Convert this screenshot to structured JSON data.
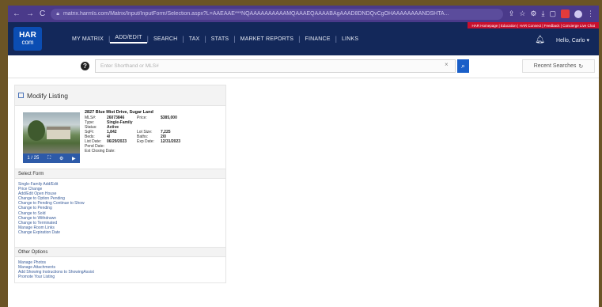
{
  "browser": {
    "nav_back": "←",
    "nav_forward": "→",
    "nav_reload": "C",
    "url": "matrix.harmls.com/Matrix/Input/InputForm/Selection.aspx?L=AAEAAE***NQAAAAAAAAAAMQAAAEQAAAABAgAAAD8DNDQvCgOHAAAAAAAANDSHTA..."
  },
  "har": {
    "logo_top": "HAR",
    "logo_bottom": "com",
    "nav": [
      {
        "label": "MY MATRIX"
      },
      {
        "label": "ADD/EDIT"
      },
      {
        "label": "SEARCH"
      },
      {
        "label": "TAX"
      },
      {
        "label": "STATS"
      },
      {
        "label": "MARKET REPORTS"
      },
      {
        "label": "FINANCE"
      },
      {
        "label": "LINKS"
      }
    ],
    "active_nav": "ADD/EDIT",
    "toplinks": "HAR Homepage | Education | HAR Connect | Feedback | Concierge Live Chat",
    "greeting": "Hello, Carlo ▾"
  },
  "search": {
    "placeholder": "Enter Shorthand or MLS#",
    "clear": "×",
    "recent_label": "Recent Searches"
  },
  "modify": {
    "title": "Modify Listing",
    "address": "2827 Blue Mist Drive, Sugar Land",
    "photo_count": "1 / 25",
    "details": [
      {
        "k": "MLS#:",
        "v": "26073846",
        "k2": "Price:",
        "v2": "$385,000"
      },
      {
        "k": "Type:",
        "v": "Single-Family",
        "k2": "",
        "v2": ""
      },
      {
        "k": "Status:",
        "v": "Active",
        "k2": "",
        "v2": ""
      },
      {
        "k": "SqFt:",
        "v": "1,842",
        "k2": "Lot Size:",
        "v2": "7,225"
      },
      {
        "k": "Beds:",
        "v": "4/",
        "k2": "Baths:",
        "v2": "2/0"
      },
      {
        "k": "List Date:",
        "v": "06/29/2023",
        "k2": "Exp Date:",
        "v2": "12/31/2023"
      },
      {
        "k": "Pend Date:",
        "v": "",
        "k2": "",
        "v2": ""
      },
      {
        "k": "Est Closing Date:",
        "v": "",
        "k2": "",
        "v2": ""
      }
    ]
  },
  "select_form": {
    "title": "Select Form",
    "items": [
      "Single-Family Add/Edit",
      "Price Change",
      "Add/Edit Open House",
      "Change to Option Pending",
      "Change to Pending Continue to Show",
      "Change to Pending",
      "Change to Sold",
      "Change to Withdrawn",
      "Change to Terminated",
      "Manage Room Links",
      "Change Expiration Date"
    ]
  },
  "other_options": {
    "title": "Other Options",
    "items": [
      "Manage Photos",
      "Manage Attachments",
      "Add Showing Instructions to ShowingAssist",
      "Promote Your Listing"
    ]
  },
  "colors": {
    "har_navy": "#13285a",
    "accent_blue": "#1a5fc8",
    "link_blue": "#3a5d9a",
    "browser_purple": "#4a3a8a"
  }
}
